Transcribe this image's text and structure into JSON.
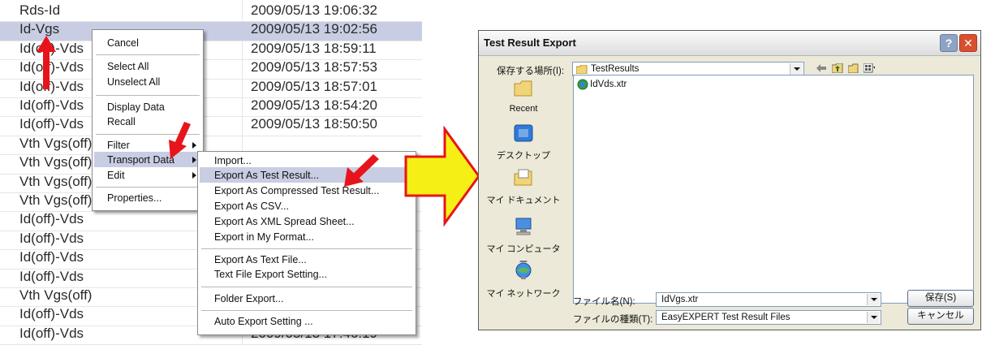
{
  "list": {
    "rows": [
      {
        "name": "Rds-Id",
        "date": "2009/05/13 19:06:32"
      },
      {
        "name": "Id-Vgs",
        "date": "2009/05/13 19:02:56"
      },
      {
        "name": "Id(off)-Vds",
        "date": "2009/05/13 18:59:11"
      },
      {
        "name": "Id(off)-Vds",
        "date": "2009/05/13 18:57:53"
      },
      {
        "name": "Id(off)-Vds",
        "date": "2009/05/13 18:57:01"
      },
      {
        "name": "Id(off)-Vds",
        "date": "2009/05/13 18:54:20"
      },
      {
        "name": "Id(off)-Vds",
        "date": "2009/05/13 18:50:50"
      },
      {
        "name": "Vth Vgs(off)",
        "date": ""
      },
      {
        "name": "Vth Vgs(off)",
        "date": ""
      },
      {
        "name": "Vth Vgs(off)",
        "date": ""
      },
      {
        "name": "Vth Vgs(off)",
        "date": ""
      },
      {
        "name": "Id(off)-Vds",
        "date": ""
      },
      {
        "name": "Id(off)-Vds",
        "date": ""
      },
      {
        "name": "Id(off)-Vds",
        "date": ""
      },
      {
        "name": "Id(off)-Vds",
        "date": ""
      },
      {
        "name": "Vth Vgs(off)",
        "date": ""
      },
      {
        "name": "Id(off)-Vds",
        "date": ""
      },
      {
        "name": "Id(off)-Vds",
        "date": "2009/05/13 17:46:19"
      }
    ],
    "selected_row": "Id-Vgs"
  },
  "context_menu": {
    "items": [
      "Cancel",
      "Select All",
      "Unselect All",
      "Display Data",
      "Recall",
      "Filter",
      "Transport Data",
      "Edit",
      "Properties..."
    ],
    "highlighted": "Transport Data"
  },
  "submenu": {
    "items": [
      "Import...",
      "Export As Test Result...",
      "Export As Compressed Test Result...",
      "Export As CSV...",
      "Export As XML Spread Sheet...",
      "Export in My Format...",
      "Export As Text File...",
      "Text File Export Setting...",
      "Folder Export...",
      "Auto Export Setting ..."
    ],
    "highlighted": "Export As Test Result..."
  },
  "dialog": {
    "title": "Test Result Export",
    "help_label": "?",
    "close_label": "✕",
    "save_in_label": "保存する場所(I):",
    "save_in_value": "TestResults",
    "files": [
      "IdVds.xtr"
    ],
    "places": [
      "Recent",
      "デスクトップ",
      "マイ ドキュメント",
      "マイ コンピューター",
      "マイ ネットワーク"
    ],
    "filename_label": "ファイル名(N):",
    "filename_value": "IdVgs.xtr",
    "filetype_label": "ファイルの種類(T):",
    "filetype_value": "EasyEXPERT Test Result Files",
    "save_button": "保存(S)",
    "cancel_button": "キャンセル"
  },
  "colors": {
    "selection": "#c8cde3",
    "annotation_arrow": "#e8141b",
    "big_arrow_fill": "#f5ef16",
    "big_arrow_outline": "#e8141b"
  }
}
